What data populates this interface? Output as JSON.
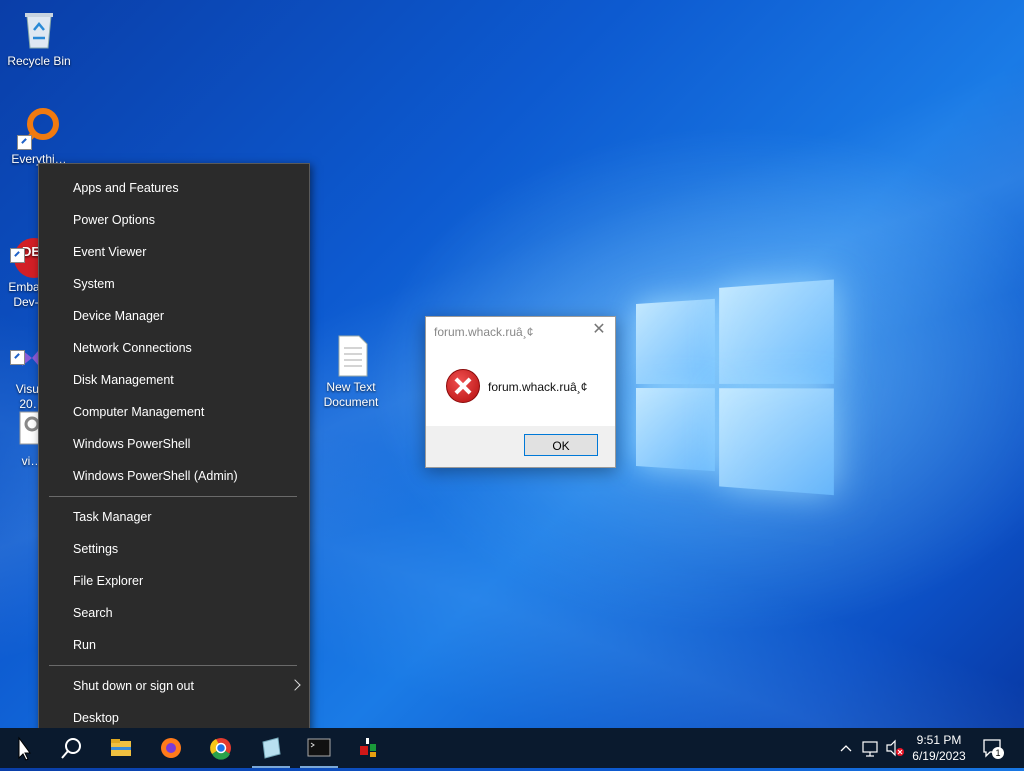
{
  "desktop": {
    "icons": [
      {
        "label": "Recycle Bin",
        "icon": "recycle-bin-icon"
      },
      {
        "label": "Everythi…",
        "icon": "everything-search-icon"
      },
      {
        "label": "Embar…\nDev-…",
        "icon": "embarcadero-dev-icon"
      },
      {
        "label": "Visual\n20…",
        "icon": "visual-studio-icon"
      },
      {
        "label": "vi…",
        "icon": "settings-file-icon"
      },
      {
        "label": "New Text\nDocument",
        "icon": "text-document-icon"
      }
    ]
  },
  "menu": {
    "group1": [
      "Apps and Features",
      "Power Options",
      "Event Viewer",
      "System",
      "Device Manager",
      "Network Connections",
      "Disk Management",
      "Computer Management",
      "Windows PowerShell",
      "Windows PowerShell (Admin)"
    ],
    "group2": [
      "Task Manager",
      "Settings",
      "File Explorer",
      "Search",
      "Run"
    ],
    "group3": [
      "Shut down or sign out",
      "Desktop"
    ]
  },
  "dialog": {
    "title": "forum.whack.ruâ¸¢",
    "message": "forum.whack.ruâ¸¢",
    "ok_label": "OK",
    "close_glyph": "✕"
  },
  "taskbar": {
    "pinned": [
      "start-icon",
      "search-icon",
      "file-explorer-icon",
      "firefox-icon",
      "chrome-icon",
      "notepad-icon",
      "terminal-icon",
      "app-icon"
    ],
    "clock": {
      "time": "9:51 PM",
      "date": "6/19/2023"
    },
    "notifications_count": "1"
  },
  "colors": {
    "menu_bg": "#2b2b2b",
    "taskbar_bg": "#0a1a2e",
    "accent": "#0078d7"
  }
}
